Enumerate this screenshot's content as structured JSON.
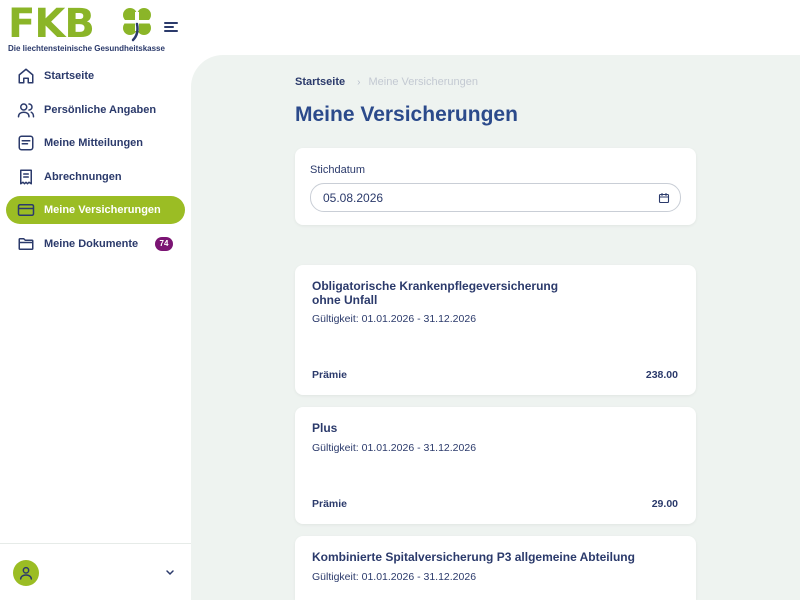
{
  "brand": {
    "logo_text": "FKB",
    "tagline": "Die liechtensteinische Gesundheitskasse",
    "primary_color": "#9bbd24",
    "navy_color": "#2b3a6b"
  },
  "sidebar": {
    "items": [
      {
        "label": "Startseite",
        "icon": "home-icon"
      },
      {
        "label": "Persönliche Angaben",
        "icon": "users-icon"
      },
      {
        "label": "Meine Mitteilungen",
        "icon": "message-icon"
      },
      {
        "label": "Abrechnungen",
        "icon": "receipt-icon"
      },
      {
        "label": "Meine Versicherungen",
        "icon": "credit-card-icon",
        "active": true
      },
      {
        "label": "Meine Dokumente",
        "icon": "folder-icon",
        "badge": "74"
      }
    ]
  },
  "breadcrumb": {
    "home": "Startseite",
    "current": "Meine Versicherungen"
  },
  "page": {
    "title": "Meine Versicherungen"
  },
  "date_filter": {
    "label": "Stichdatum",
    "value": "05.08.2026"
  },
  "insurances": [
    {
      "title": "Obligatorische Krankenpflegeversicherung ohne Unfall",
      "validity": "Gültigkeit: 01.01.2026 - 31.12.2026",
      "premium_label": "Prämie",
      "premium_value": "238.00"
    },
    {
      "title": "Plus",
      "validity": "Gültigkeit: 01.01.2026 - 31.12.2026",
      "premium_label": "Prämie",
      "premium_value": "29.00"
    },
    {
      "title": "Kombinierte Spitalversicherung P3 allgemeine Abteilung",
      "validity": "Gültigkeit: 01.01.2026 - 31.12.2026",
      "premium_label": "",
      "premium_value": ""
    }
  ]
}
